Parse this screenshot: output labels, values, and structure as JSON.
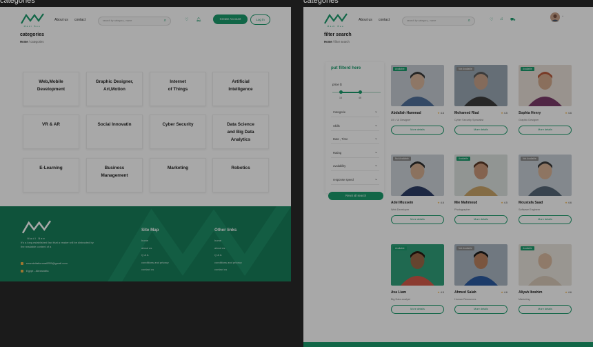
{
  "left": {
    "frame_label": "categories",
    "nav": {
      "logo_text": "Madi Bee",
      "links": [
        "About us",
        "contact"
      ],
      "search_placeholder": "search by category , name",
      "create_account": "Create Account",
      "login": "Log in"
    },
    "page_title": "categories",
    "breadcrumb": {
      "home": "Home",
      "sep": " / ",
      "current": "categories"
    },
    "categories": [
      "Web,Mobile\nDevelopment",
      "Graphic Designer,\nArt,Motion",
      "Internet\nof Things",
      "Artificial\nIntelligence",
      "VR & AR",
      "Social Innovatin",
      "Cyber Security",
      "Data Science\nand Big Data\nAnalytics",
      "E-Learning",
      "Business\nManagement",
      "Marketing",
      "Robotics"
    ],
    "footer": {
      "logo_text": "Madi Bee",
      "description": "It's a long established fact that a reader will be distracted by the readable content of a",
      "email": "examinitationmail255@gmail.com",
      "location": "Egypt - Alexandria",
      "sitemap_title": "Site Map",
      "sitemap_links": [
        "home",
        "about us",
        "Q & A",
        "conditions and privacy",
        "contact us"
      ],
      "other_title": "Other links",
      "other_links": [
        "home",
        "about us",
        "Q & A",
        "conditions and privacy",
        "contact us"
      ]
    }
  },
  "right": {
    "frame_label": "categories",
    "nav": {
      "links": [
        "About us",
        "contact"
      ],
      "search_placeholder": "search by category , name"
    },
    "page_title": "filter search",
    "breadcrumb": {
      "home": "Home",
      "sep": " / ",
      "current": "filter search"
    },
    "filters": {
      "title": "put filterd here",
      "price_label": "price $",
      "price_min": "15",
      "price_max": "45",
      "selects": [
        "Categorie",
        "Skills",
        "Date , Time",
        "Rating",
        "avalability",
        "response speed"
      ],
      "reset": "Reset all search"
    },
    "mentors": [
      {
        "name": "Abdallah Hammad",
        "rating": "4.6",
        "role": "UX / UI Designer",
        "badge": "Available",
        "more": "More details"
      },
      {
        "name": "Mohamed Riad",
        "rating": "4.5",
        "role": "Cyber Security Specialist",
        "badge": "Not Available",
        "more": "More details"
      },
      {
        "name": "Sophia Henry",
        "rating": "4.6",
        "role": "Graphic Designer",
        "badge": "Available",
        "more": "More details"
      },
      {
        "name": "Adel Mussein",
        "rating": "4.6",
        "role": "Web Developer",
        "badge": "Not Available",
        "more": "More details"
      },
      {
        "name": "Mie Mahmoud",
        "rating": "4.5",
        "role": "Photographer",
        "badge": "Available",
        "more": "More details"
      },
      {
        "name": "Moustafa Saad",
        "rating": "4.6",
        "role": "Software Engineer",
        "badge": "Not Available",
        "more": "More details"
      },
      {
        "name": "Ava Liam",
        "rating": "4.5",
        "role": "Big Data analyst",
        "badge": "Available",
        "more": "More details"
      },
      {
        "name": "Ahmed Salah",
        "rating": "4.6",
        "role": "Human Resources",
        "badge": "Not Available",
        "more": "More details"
      },
      {
        "name": "Aliyah Ibrahim",
        "rating": "4.6",
        "role": "Marketing",
        "badge": "Available",
        "more": "More details"
      }
    ]
  },
  "colors": {
    "brand": "#1a9b6c",
    "footer": "#187e5a",
    "star": "#f0b24a",
    "available": "#1a9b6c",
    "not_available": "#8a8a8a"
  }
}
